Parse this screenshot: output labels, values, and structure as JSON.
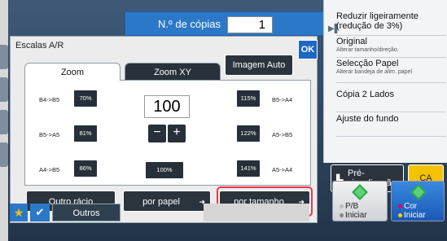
{
  "header": {
    "copies_label": "N.º de cópias",
    "copies_value": "1"
  },
  "right_panel": {
    "items": [
      {
        "title": "Reduzir ligeiramente (redução de 3%)",
        "sub": ""
      },
      {
        "title": "Original",
        "sub": "Alterar tamanho/direção."
      },
      {
        "title": "Selecção Papel",
        "sub": "Alterar bandeja de alim. papel"
      },
      {
        "title": "Cópia 2 Lados",
        "sub": ""
      },
      {
        "title": "Ajuste do fundo",
        "sub": ""
      }
    ]
  },
  "dialog": {
    "title": "Escalas A/R",
    "ok": "OK",
    "tabs": [
      "Zoom",
      "Zoom XY"
    ],
    "image_auto": "Imagem Auto",
    "value": "100",
    "minus": "−",
    "plus": "+",
    "presets_left": [
      {
        "label": "B4->B5",
        "btn": "70%"
      },
      {
        "label": "B5->A5",
        "btn": "81%"
      },
      {
        "label": "A4->B5",
        "btn": "86%"
      }
    ],
    "center_btn": "100%",
    "presets_right": [
      {
        "label": "B5->A4",
        "btn": "115%"
      },
      {
        "label": "A5->B5",
        "btn": "122%"
      },
      {
        "label": "A5->A4",
        "btn": "141%"
      }
    ],
    "bottom": {
      "other_ratio": "Outro rácio",
      "by_paper": "por papel",
      "by_size": "por tamanho"
    }
  },
  "bottom_bar": {
    "outros": "Outros"
  },
  "controls": {
    "preview": "Pré-visualização",
    "ca": "CA",
    "start_bw": [
      "P/B",
      "Iniciar"
    ],
    "start_color": [
      "Cor",
      "Iniciar"
    ]
  },
  "colors": {
    "accent": "#2b78c8",
    "highlight": "#e8394d",
    "ca": "#f3c300"
  }
}
